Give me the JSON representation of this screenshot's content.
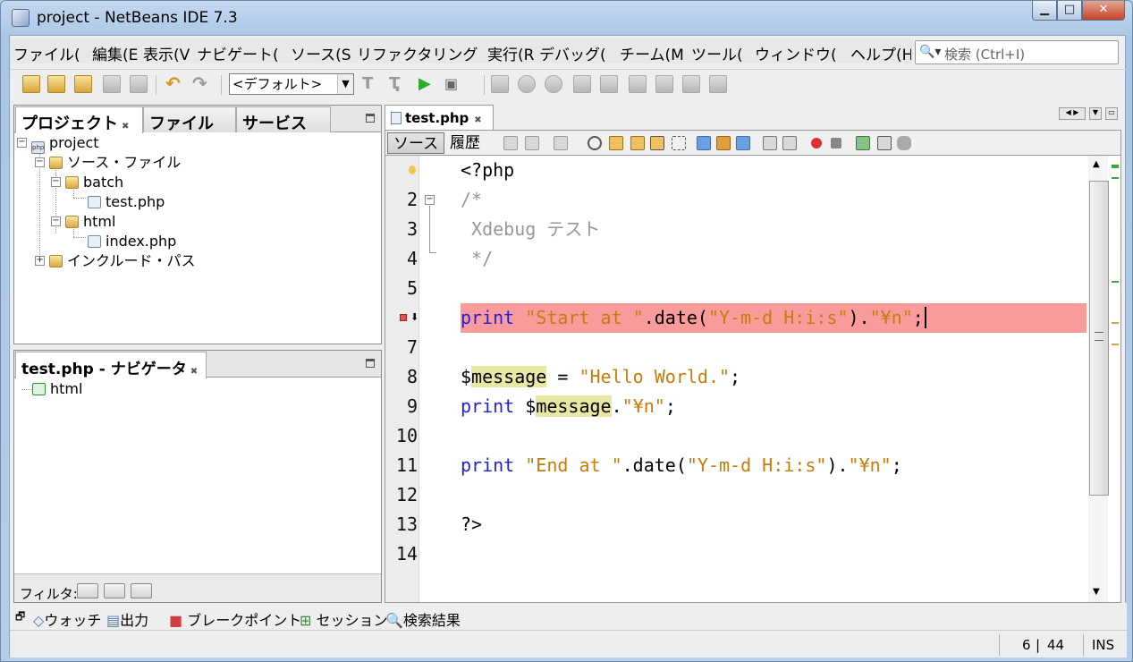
{
  "window": {
    "title": "project - NetBeans IDE 7.3"
  },
  "menu": [
    "ファイル(",
    "編集(E",
    "表示(V",
    "ナビゲート(",
    "ソース(S",
    "リファクタリング",
    "実行(R",
    "デバッグ(",
    "チーム(M",
    "ツール(",
    "ウィンドウ(",
    "ヘルプ(H"
  ],
  "search": {
    "icon": "search-icon",
    "placeholder": "検索 (Ctrl+I)"
  },
  "toolbar": {
    "config_combo": "<デフォルト>"
  },
  "projects_panel": {
    "tabs": [
      "プロジェクト",
      "ファイル",
      "サービス"
    ],
    "tree": {
      "project": "project",
      "sources": "ソース・ファイル",
      "batch": "batch",
      "test_php": "test.php",
      "html": "html",
      "index_php": "index.php",
      "include_path": "インクルード・パス"
    }
  },
  "navigator_panel": {
    "title": "test.php - ナビゲータ",
    "root": "html",
    "filter_label": "フィルタ:"
  },
  "editor": {
    "tab": "test.php",
    "view_source": "ソース",
    "view_history": "履歴",
    "line_numbers": [
      "2",
      "3",
      "4",
      "5",
      "7",
      "8",
      "9",
      "10",
      "11",
      "12",
      "13",
      "14"
    ],
    "lines": {
      "l1": "<?php",
      "l2": "/*",
      "l3": " Xdebug テスト",
      "l4": " */",
      "l6_kw": "print",
      "l6_s1": " \"Start at \"",
      "l6_mid": ".date(",
      "l6_s2": "\"Y-m-d H:i:s\"",
      "l6_mid2": ").",
      "l6_s3": "\"¥n\"",
      "l6_end": ";",
      "l8_d": "$",
      "l8_var": "message",
      "l8_eq": " = ",
      "l8_s": "\"Hello World.\"",
      "l8_end": ";",
      "l9_kw": "print",
      "l9_d": " $",
      "l9_var": "message",
      "l9_mid": ".",
      "l9_s": "\"¥n\"",
      "l9_end": ";",
      "l11_kw": "print",
      "l11_s1": " \"End at \"",
      "l11_mid": ".date(",
      "l11_s2": "\"Y-m-d H:i:s\"",
      "l11_mid2": ").",
      "l11_s3": "\"¥n\"",
      "l11_end": ";",
      "l13": "?>"
    }
  },
  "bottom_tabs": [
    "ウォッチ",
    "出力",
    "ブレークポイント",
    "セッション",
    "検索結果"
  ],
  "status": {
    "line": "6",
    "col": "44",
    "mode": "INS"
  },
  "colors": {
    "breakpoint": "#fa9b9b",
    "keyword": "#1f1fe0",
    "string": "#c67b0b",
    "comment": "#969696",
    "var_highlight": "#e9e7a4"
  }
}
